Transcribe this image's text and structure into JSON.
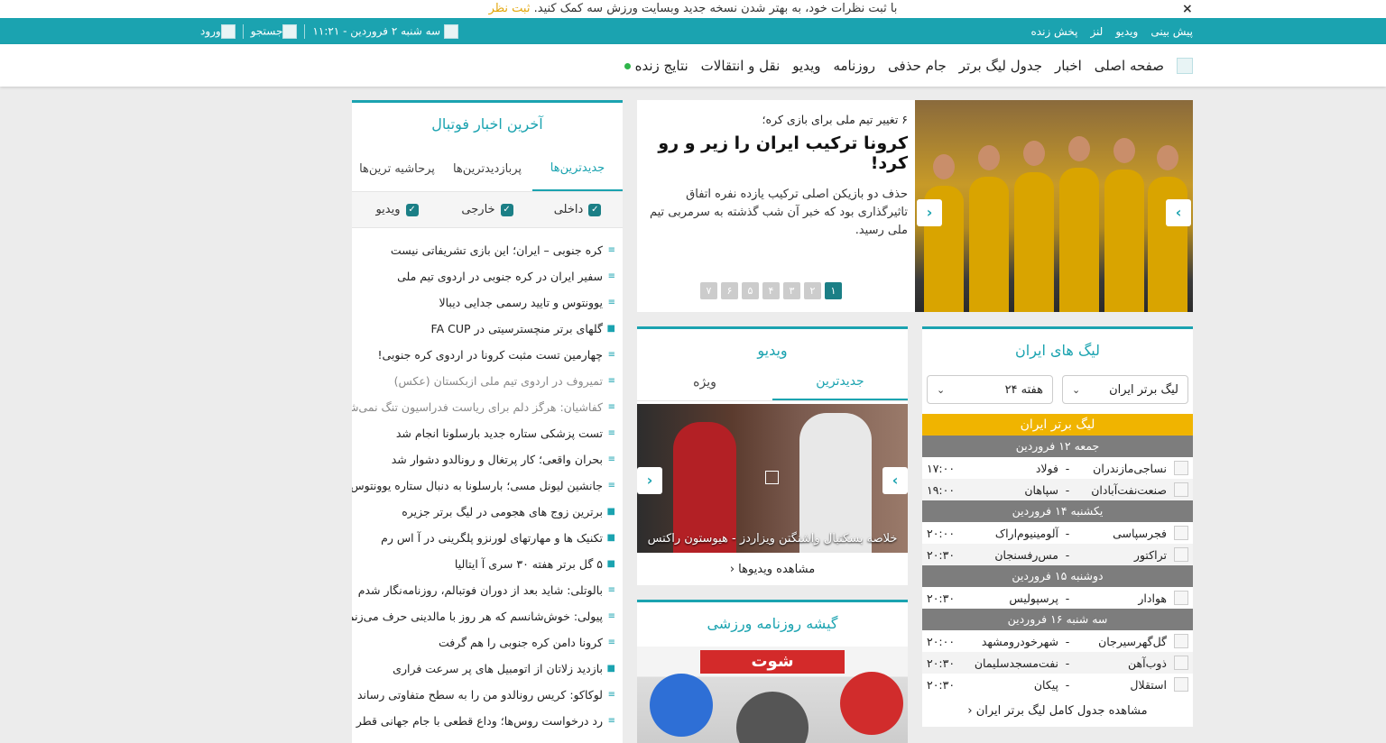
{
  "notice": {
    "text": "با ثبت نظرات خود، به بهتر شدن نسخه جدید وبسایت ورزش سه کمک کنید.",
    "link": "ثبت نظر",
    "close": "×"
  },
  "topbar": {
    "links": [
      "پیش بینی",
      "ویدیو",
      "لنز",
      "پخش زنده"
    ],
    "date": "سه شنبه ۲ فروردین - ۱۱:۲۱",
    "search_label": "جستجو",
    "login_label": "ورود"
  },
  "nav": {
    "items": [
      "صفحه اصلی",
      "اخبار",
      "جدول لیگ برتر",
      "جام حذفی",
      "روزنامه",
      "ویدیو",
      "نقل و انتقالات",
      "نتایج زنده"
    ]
  },
  "hero": {
    "subtitle": "۶ تغییر تیم ملی برای بازی کره؛",
    "title": "کرونا ترکیب ایران را زیر و رو کرد!",
    "description": "حذف دو بازیکن اصلی ترکیب یازده نفره اتفاق تاثیرگذاری بود که خبر آن شب گذشته به سرمربی تیم ملی رسید.",
    "pages": [
      "۱",
      "۲",
      "۳",
      "۴",
      "۵",
      "۶",
      "۷"
    ],
    "active_page": 0
  },
  "news": {
    "title": "آخرین اخبار فوتبال",
    "tabs": [
      "جدیدترین‌ها",
      "پربازدیدترین‌ها",
      "پرحاشیه ترین‌ها"
    ],
    "filters": [
      "داخلی",
      "خارجی",
      "ویدیو"
    ],
    "items": [
      {
        "text": "کره جنوبی – ایران؛ این بازی تشریفاتی نیست",
        "type": "text",
        "muted": false
      },
      {
        "text": "سفیر ایران در کره جنوبی در اردوی تیم ملی",
        "type": "text",
        "muted": false
      },
      {
        "text": "یوونتوس و تایید رسمی جدایی دیبالا",
        "type": "text",
        "muted": false
      },
      {
        "text": "گلهای برتر منچسترسیتی در FA CUP",
        "type": "video",
        "muted": false
      },
      {
        "text": "چهارمین تست مثبت کرونا در اردوی کره جنوبی!",
        "type": "text",
        "muted": false
      },
      {
        "text": "تمیروف در اردوی تیم ملی ازبکستان (عکس)",
        "type": "text",
        "muted": true
      },
      {
        "text": "کفاشیان: هرگز دلم برای ریاست فدراسیون تنگ نمی‌شود",
        "type": "text",
        "muted": true
      },
      {
        "text": "تست پزشکی ستاره جدید بارسلونا انجام شد",
        "type": "text",
        "muted": false
      },
      {
        "text": "بحران واقعی؛ کار پرتغال و رونالدو دشوار شد",
        "type": "text",
        "muted": false
      },
      {
        "text": "جانشین لیونل مسی؛ بارسلونا به دنبال ستاره یوونتوس",
        "type": "text",
        "muted": false
      },
      {
        "text": "برترین زوج های هجومی در لیگ برتر جزیره",
        "type": "video",
        "muted": false
      },
      {
        "text": "تکنیک ها و مهارتهای لورنزو پلگرینی در آ اس رم",
        "type": "video",
        "muted": false
      },
      {
        "text": "۵ گل برتر هفته ۳۰ سری آ ایتالیا",
        "type": "video",
        "muted": false
      },
      {
        "text": "بالوتلی: شاید بعد از دوران فوتبالم، روزنامه‌نگار شدم",
        "type": "text",
        "muted": false
      },
      {
        "text": "پیولی: خوش‌شانسم که هر روز با مالدینی حرف می‌زنم",
        "type": "text",
        "muted": false
      },
      {
        "text": "کرونا دامن کره جنوبی را هم گرفت",
        "type": "text",
        "muted": false
      },
      {
        "text": "بازدید زلاتان از اتومبیل های پر سرعت فراری",
        "type": "video",
        "muted": false
      },
      {
        "text": "لوکاکو: کریس رونالدو من را به سطح متفاوتی رساند",
        "type": "text",
        "muted": false
      },
      {
        "text": "رد درخواست روس‌ها؛ وداع قطعی با جام جهانی قطر",
        "type": "text",
        "muted": false
      }
    ]
  },
  "video": {
    "title": "ویدیو",
    "tabs": [
      "جدیدترین",
      "ویژه"
    ],
    "caption": "خلاصه بسکتبال واشنگتن ویزاردز - هیوستون راکتس",
    "more": "مشاهده ویدیوها"
  },
  "press": {
    "title": "گیشه روزنامه ورزشی",
    "masthead": "شوت"
  },
  "league": {
    "title": "لیگ های ایران",
    "select_league": "لیگ برتر ایران",
    "select_week": "هفته ۲۴",
    "header": "لیگ برتر ایران",
    "days": [
      {
        "day": "جمعه ۱۲ فروردین",
        "matches": [
          {
            "home": "نساجی‌مازندران",
            "away": "فولاد",
            "time": "۱۷:۰۰"
          },
          {
            "home": "صنعت‌نفت‌آبادان",
            "away": "سپاهان",
            "time": "۱۹:۰۰"
          }
        ]
      },
      {
        "day": "یکشنبه ۱۴ فروردین",
        "matches": [
          {
            "home": "فجرسپاسی",
            "away": "آلومینیوم‌اراک",
            "time": "۲۰:۰۰"
          },
          {
            "home": "تراکتور",
            "away": "مس‌رفسنجان",
            "time": "۲۰:۳۰"
          }
        ]
      },
      {
        "day": "دوشنبه ۱۵ فروردین",
        "matches": [
          {
            "home": "هوادار",
            "away": "پرسپولیس",
            "time": "۲۰:۳۰"
          }
        ]
      },
      {
        "day": "سه شنبه ۱۶ فروردین",
        "matches": [
          {
            "home": "گل‌گهرسیرجان",
            "away": "شهرخودرومشهد",
            "time": "۲۰:۰۰"
          },
          {
            "home": "ذوب‌آهن",
            "away": "نفت‌مسجدسلیمان",
            "time": "۲۰:۳۰"
          },
          {
            "home": "استقلال",
            "away": "پیکان",
            "time": "۲۰:۳۰"
          }
        ]
      }
    ],
    "more": "مشاهده جدول کامل لیگ برتر ایران"
  },
  "colors": {
    "accent": "#1ba3b0",
    "league_header": "#f0b400",
    "day_row": "#7d7d7d"
  }
}
